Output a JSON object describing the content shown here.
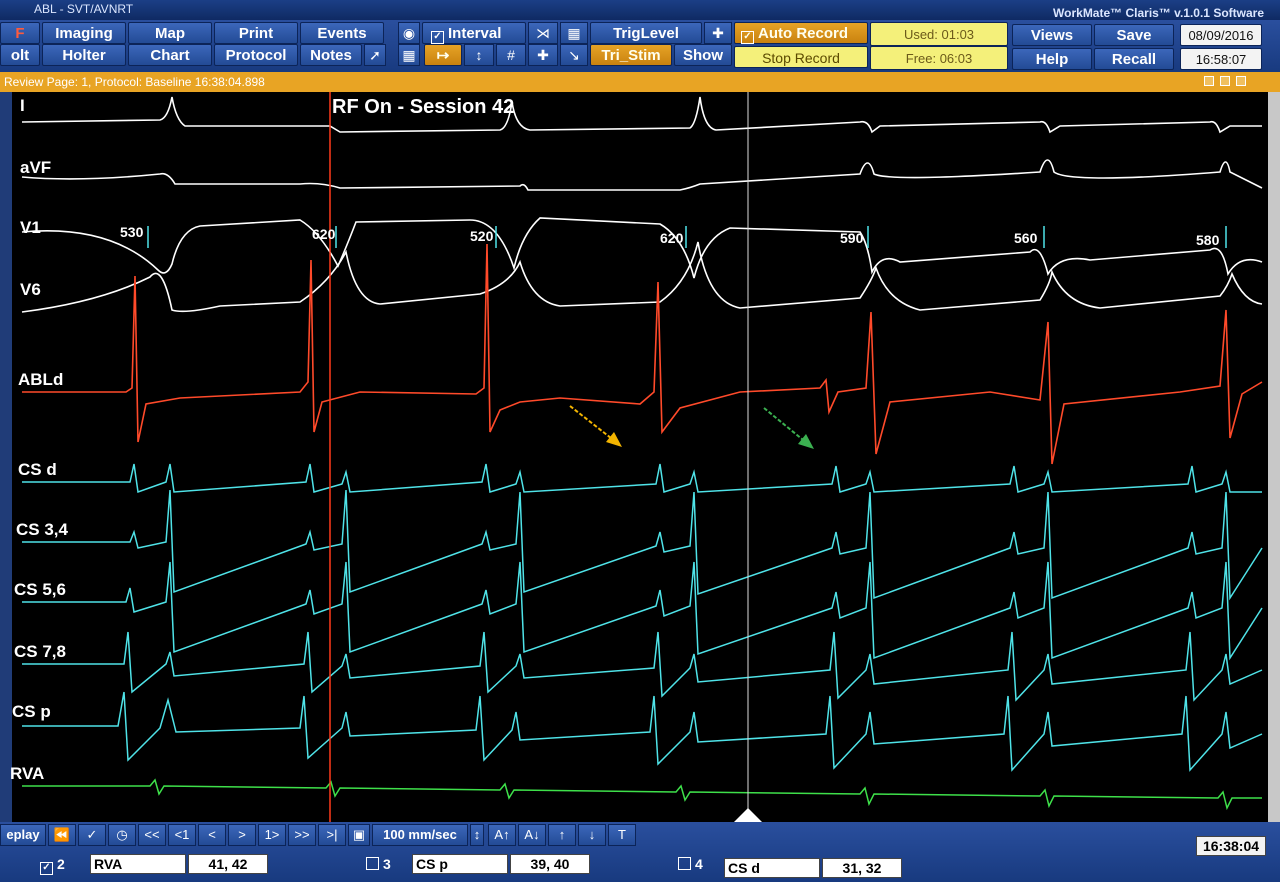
{
  "window": {
    "title": "ABL - SVT/AVNRT",
    "product": "WorkMate™ Claris™ v.1.0.1 Software"
  },
  "toolbar": {
    "row1": [
      "Imaging",
      "Map",
      "Print",
      "Events",
      "Interval",
      "TrigLevel",
      "Auto Record",
      "Views",
      "Save"
    ],
    "row2": [
      "Holter",
      "Chart",
      "Protocol",
      "Notes",
      "Tri_Stim",
      "Show",
      "Stop Record",
      "Help",
      "Recall"
    ],
    "left_row1": "F",
    "left_row2": "olt",
    "used": "Used: 01:03",
    "free": "Free: 06:03",
    "date": "08/09/2016",
    "time": "16:58:07"
  },
  "review": {
    "text": "Review Page: 1, Protocol: Baseline  16:38:04.898"
  },
  "banner": "RF On - Session 42",
  "channels": [
    "I",
    "aVF",
    "V1",
    "V6",
    "ABLd",
    "CS d",
    "CS 3,4",
    "CS 5,6",
    "CS 7,8",
    "CS p",
    "RVA"
  ],
  "intervals": [
    "530",
    "620",
    "520",
    "620",
    "590",
    "560",
    "580"
  ],
  "bottom": {
    "replay": "eplay",
    "nav": [
      "<<",
      "<1",
      "<",
      ">",
      "1>",
      ">>",
      ">|"
    ],
    "speed": "100 mm/sec",
    "timestamp": "16:38:04",
    "slots": [
      {
        "num": "2",
        "checked": true,
        "name": "RVA",
        "pins": "41, 42"
      },
      {
        "num": "3",
        "checked": false,
        "name": "CS p",
        "pins": "39, 40"
      },
      {
        "num": "4",
        "checked": false,
        "name": "CS d",
        "pins": "31, 32"
      }
    ]
  },
  "colors": {
    "surface": "#ffffff",
    "abl": "#ff4a2a",
    "cs": "#4fe3e8",
    "rva": "#3ee04a",
    "cursor": "#ff3a1a",
    "toolbar": "#234b95",
    "review": "#e8a424"
  }
}
